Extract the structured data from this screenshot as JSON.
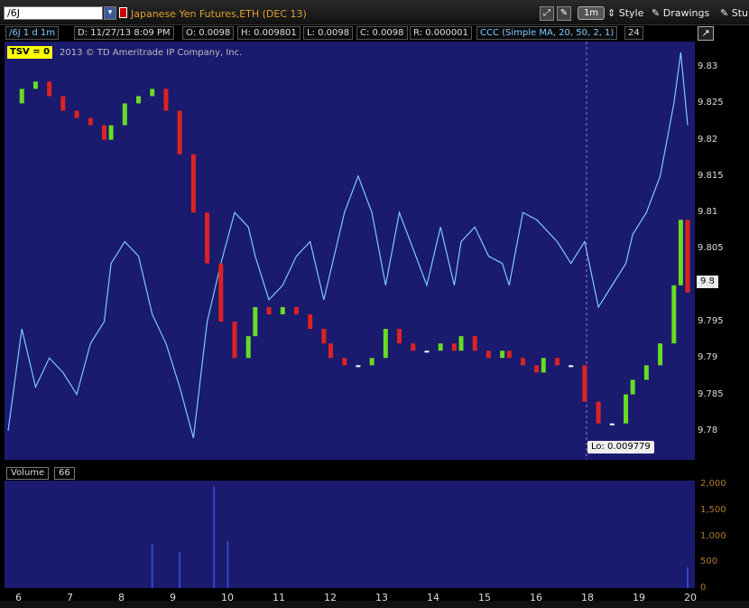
{
  "toolbar": {
    "symbol": "/6J",
    "description": "Japanese Yen Futures,ETH (DEC 13)",
    "aggregation": "1m",
    "style_label": "Style",
    "drawings_label": "Drawings",
    "studies_label": "Stu"
  },
  "info": {
    "symbol_period": "/6J 1 d 1m",
    "date": "D: 11/27/13 8:09 PM",
    "open": "O: 0.0098",
    "high": "H: 0.009801",
    "low": "L: 0.0098",
    "close": "C: 0.0098",
    "range": "R: 0.000001",
    "study": "CCC (Simple MA, 20, 50, 2, 1)",
    "study_value": "24"
  },
  "tsv_label": "TSV  = 0",
  "copyright": "2013 © TD Ameritrade IP Company, Inc.",
  "lo_label": "Lo: 0.009779",
  "last_price_label": "9.8",
  "volume": {
    "label": "Volume",
    "value": "66"
  },
  "colors": {
    "plot_bg": "#1a1a6e",
    "up": "#66dd22",
    "down": "#dd2222",
    "flat": "#ffffff",
    "study_line": "#7ec8ff",
    "volume": "#3344cc"
  },
  "chart_data": [
    {
      "type": "line",
      "title": "Japanese Yen Futures,ETH (DEC 13)",
      "y_ticks": [
        "9.78",
        "9.785",
        "9.79",
        "9.795",
        "9.8",
        "9.805",
        "9.81",
        "9.815",
        "9.82",
        "9.825",
        "9.83"
      ],
      "ylim": [
        9.776,
        9.8335
      ],
      "x_ticks": [
        "6",
        "7",
        "8",
        "9",
        "10",
        "11",
        "12",
        "13",
        "14",
        "15",
        "16",
        "18",
        "19",
        "20"
      ],
      "price_series": {
        "name": "/6J",
        "x": [
          0,
          2,
          4,
          6,
          8,
          10,
          12,
          14,
          15,
          17,
          19,
          21,
          23,
          25,
          27,
          29,
          31,
          33,
          35,
          36,
          38,
          40,
          42,
          44,
          46,
          47,
          49,
          51,
          53,
          55,
          57,
          59,
          61,
          63,
          65,
          66,
          68,
          70,
          72,
          73,
          75,
          77,
          78,
          80,
          82,
          84,
          86,
          88,
          90,
          91,
          93,
          95,
          97,
          98,
          99
        ],
        "y": [
          9.825,
          9.827,
          9.828,
          9.826,
          9.824,
          9.823,
          9.822,
          9.82,
          9.822,
          9.825,
          9.826,
          9.827,
          9.824,
          9.818,
          9.81,
          9.803,
          9.795,
          9.79,
          9.793,
          9.797,
          9.796,
          9.797,
          9.796,
          9.794,
          9.792,
          9.79,
          9.789,
          9.789,
          9.79,
          9.794,
          9.792,
          9.791,
          9.791,
          9.792,
          9.791,
          9.793,
          9.791,
          9.79,
          9.791,
          9.79,
          9.789,
          9.788,
          9.79,
          9.789,
          9.789,
          9.784,
          9.781,
          9.781,
          9.785,
          9.787,
          9.789,
          9.792,
          9.8,
          9.809,
          9.799
        ]
      },
      "study_series": {
        "name": "CCC",
        "x": [
          0,
          2,
          4,
          6,
          8,
          10,
          12,
          14,
          15,
          17,
          19,
          21,
          23,
          25,
          27,
          29,
          31,
          33,
          35,
          36,
          38,
          40,
          42,
          44,
          46,
          47,
          49,
          51,
          53,
          55,
          57,
          59,
          61,
          63,
          65,
          66,
          68,
          70,
          72,
          73,
          75,
          77,
          78,
          80,
          82,
          84,
          86,
          88,
          90,
          91,
          93,
          95,
          97,
          98,
          99
        ],
        "y": [
          9.78,
          9.794,
          9.786,
          9.79,
          9.788,
          9.785,
          9.792,
          9.795,
          9.803,
          9.806,
          9.804,
          9.796,
          9.792,
          9.786,
          9.779,
          9.795,
          9.803,
          9.81,
          9.808,
          9.804,
          9.798,
          9.8,
          9.804,
          9.806,
          9.798,
          9.802,
          9.81,
          9.815,
          9.81,
          9.8,
          9.81,
          9.805,
          9.8,
          9.808,
          9.8,
          9.806,
          9.808,
          9.804,
          9.803,
          9.8,
          9.81,
          9.809,
          9.808,
          9.806,
          9.803,
          9.806,
          9.797,
          9.8,
          9.803,
          9.807,
          9.81,
          9.815,
          9.825,
          9.832,
          9.822
        ]
      }
    },
    {
      "type": "bar",
      "title": "Volume",
      "y_ticks": [
        "0",
        "500",
        "1,000",
        "1,500",
        "2,000"
      ],
      "ylim": [
        0,
        2000
      ],
      "peaks": [
        {
          "x": 30,
          "value": 1950
        },
        {
          "x": 32,
          "value": 900
        },
        {
          "x": 21,
          "value": 850
        },
        {
          "x": 25,
          "value": 700
        },
        {
          "x": 99,
          "value": 400
        }
      ]
    }
  ]
}
